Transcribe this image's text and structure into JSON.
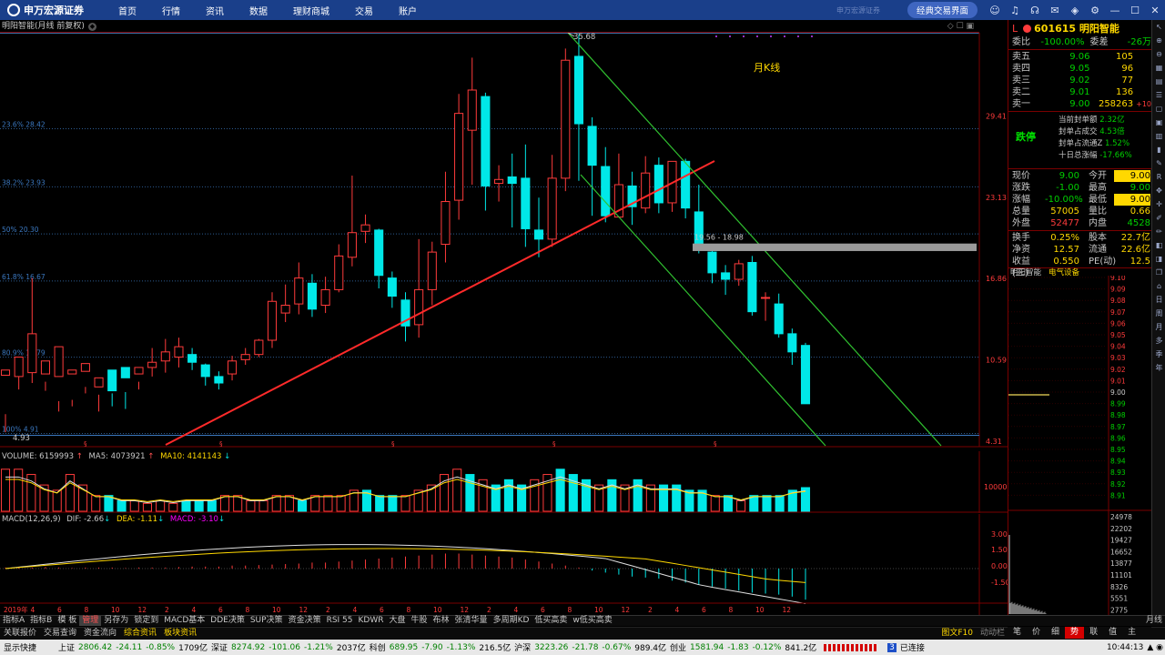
{
  "topbar": {
    "logo": "申万宏源证券",
    "menu": [
      "首页",
      "行情",
      "资讯",
      "数据",
      "理财商城",
      "交易",
      "账户"
    ],
    "broker_text": "申万宏源证券",
    "classic_button": "经典交易界面"
  },
  "chart": {
    "title": "明阳智能(月线 前复权)",
    "period_label": "月K线",
    "high_label": "35.68",
    "low_label": "4.93",
    "gap_label": "19.56 - 18.98",
    "fib_labels": [
      "23.6% 28.42",
      "38.2% 23.93",
      "50% 20.30",
      "61.8% 16.67",
      "80.9% 10.79",
      "100% 4.91"
    ],
    "price_axis": [
      "29.41",
      "23.13",
      "16.86",
      "10.59",
      "4.31"
    ],
    "time_axis": [
      "2019年",
      "4",
      "6",
      "8",
      "10",
      "12",
      "2",
      "4",
      "6",
      "8",
      "10",
      "12",
      "2",
      "4",
      "6",
      "8",
      "10",
      "12",
      "2",
      "4",
      "6",
      "8",
      "10",
      "12",
      "2",
      "4",
      "6",
      "8",
      "10",
      "12"
    ],
    "period_text": "月线"
  },
  "chart_data": {
    "type": "candlestick",
    "ylim": [
      4.31,
      35.68
    ],
    "candles": [
      [
        9.4,
        9.8,
        6.4,
        5.0
      ],
      [
        9.3,
        10.8,
        9.4,
        8.3
      ],
      [
        9.6,
        12.6,
        16.9,
        8.8
      ],
      [
        9.5,
        10.5,
        8.9,
        8.2
      ],
      [
        9.3,
        11.6,
        7.4,
        6.6
      ],
      [
        9.5,
        9.8,
        7.5,
        7.0
      ],
      [
        9.7,
        10.3,
        8.5,
        8.0
      ],
      [
        8.5,
        9.2,
        6.6,
        7.9
      ],
      [
        9.8,
        8.2,
        8.0,
        7.0
      ],
      [
        10.0,
        9.2,
        6.8,
        8.1
      ],
      [
        9.5,
        10.0,
        8.9,
        8.3
      ],
      [
        10.0,
        10.4,
        11.5,
        9.3
      ],
      [
        10.5,
        11.2,
        12.2,
        9.6
      ],
      [
        10.8,
        11.6,
        12.3,
        10.0
      ],
      [
        11.0,
        10.4,
        11.5,
        9.8
      ],
      [
        10.2,
        9.3,
        10.3,
        8.6
      ],
      [
        9.3,
        8.8,
        9.7,
        8.3
      ],
      [
        9.5,
        10.5,
        10.9,
        9.0
      ],
      [
        10.6,
        11.0,
        11.5,
        10.2
      ],
      [
        11.0,
        12.1,
        12.2,
        10.8
      ],
      [
        12.1,
        15.1,
        15.8,
        11.5
      ],
      [
        14.2,
        14.8,
        16.4,
        13.5
      ],
      [
        14.9,
        16.9,
        18.1,
        14.1
      ],
      [
        16.5,
        14.5,
        17.2,
        13.9
      ],
      [
        14.8,
        16.0,
        17.0,
        14.2
      ],
      [
        16.0,
        18.6,
        19.5,
        15.8
      ],
      [
        18.5,
        20.4,
        24.8,
        17.8
      ],
      [
        20.5,
        21.0,
        21.8,
        19.6
      ],
      [
        20.6,
        17.1,
        20.7,
        16.1
      ],
      [
        16.9,
        15.5,
        17.4,
        14.6
      ],
      [
        15.2,
        13.2,
        15.8,
        12.0
      ],
      [
        13.3,
        16.0,
        19.9,
        12.3
      ],
      [
        16.0,
        18.9,
        19.7,
        14.8
      ],
      [
        19.5,
        22.8,
        25.1,
        18.1
      ],
      [
        22.9,
        29.6,
        31.1,
        21.4
      ],
      [
        28.3,
        31.4,
        33.9,
        24.1
      ],
      [
        30.9,
        24.0,
        31.2,
        22.1
      ],
      [
        24.2,
        24.5,
        25.6,
        22.8
      ],
      [
        24.7,
        24.2,
        26.5,
        20.8
      ],
      [
        24.6,
        20.7,
        27.2,
        19.3
      ],
      [
        20.6,
        19.9,
        23.1,
        18.5
      ],
      [
        19.9,
        24.6,
        26.4,
        19.3
      ],
      [
        24.6,
        33.7,
        34.6,
        23.6
      ],
      [
        34.0,
        28.8,
        35.7,
        24.4
      ],
      [
        28.6,
        25.6,
        29.3,
        21.7
      ],
      [
        25.5,
        21.7,
        27.0,
        21.2
      ],
      [
        21.6,
        24.1,
        26.5,
        22.1
      ],
      [
        24.0,
        22.4,
        25.1,
        21.0
      ],
      [
        22.3,
        25.0,
        26.3,
        21.9
      ],
      [
        25.6,
        22.7,
        26.2,
        21.9
      ],
      [
        22.7,
        25.9,
        25.9,
        22.0
      ],
      [
        25.9,
        22.3,
        26.1,
        21.5
      ],
      [
        22.0,
        19.1,
        24.1,
        18.8
      ],
      [
        18.9,
        17.3,
        19.5,
        16.5
      ],
      [
        17.3,
        16.8,
        17.9,
        15.6
      ],
      [
        16.8,
        18.0,
        18.3,
        16.3
      ],
      [
        18.1,
        14.3,
        18.6,
        14.0
      ],
      [
        15.4,
        15.4,
        15.8,
        13.6
      ],
      [
        14.9,
        12.6,
        15.7,
        12.3
      ],
      [
        12.6,
        11.2,
        13.0,
        10.2
      ],
      [
        11.7,
        7.2,
        11.9,
        7.2
      ]
    ],
    "volume": {
      "label": "VOLUME: 6159993",
      "ma5": "MA5: 4073921",
      "ma10": "MA10: 4141143",
      "axis": "10000",
      "bars": [
        8,
        8,
        7,
        5,
        4,
        7,
        5,
        3,
        3,
        2,
        2,
        1.5,
        2,
        1.5,
        2,
        2,
        2,
        3,
        3,
        2,
        2,
        3,
        3,
        2,
        3,
        3,
        3,
        4,
        4,
        3,
        3,
        3,
        4,
        5,
        7,
        8,
        7,
        6,
        5,
        6,
        5,
        6,
        7,
        8,
        7,
        6,
        5,
        6,
        5,
        6,
        5,
        5,
        5,
        4,
        4,
        3,
        3,
        2,
        3,
        3,
        3,
        4,
        4.5
      ]
    },
    "macd": {
      "label": "MACD(12,26,9)",
      "dif": "DIF: -2.66",
      "dea": "DEA: -1.11",
      "macd": "MACD: -3.10",
      "axis": [
        "3.00",
        "1.50",
        "0.00",
        "-1.50"
      ]
    }
  },
  "quote": {
    "code": "601615",
    "name": "明阳智能",
    "order_ratio_label": "委比",
    "order_ratio": "-100.00%",
    "order_diff_label": "委差",
    "order_diff": "-26万",
    "sells": [
      {
        "label": "卖五",
        "price": "9.06",
        "vol": "105",
        "chg": ""
      },
      {
        "label": "卖四",
        "price": "9.05",
        "vol": "96",
        "chg": ""
      },
      {
        "label": "卖三",
        "price": "9.02",
        "vol": "77",
        "chg": ""
      },
      {
        "label": "卖二",
        "price": "9.01",
        "vol": "136",
        "chg": ""
      },
      {
        "label": "卖一",
        "price": "9.00",
        "vol": "258263",
        "chg": "+10"
      }
    ],
    "limit_label": "跌停",
    "limit_rows": [
      {
        "k": "当前封单额",
        "v": "2.32亿"
      },
      {
        "k": "封单占成交",
        "v": "4.53倍"
      },
      {
        "k": "封单占流通Z",
        "v": "1.52%"
      },
      {
        "k": "十日总涨幅",
        "v": "-17.66%"
      }
    ],
    "stats": [
      {
        "a": "现价",
        "b": "9.00",
        "c": "今开",
        "d": "9.00"
      },
      {
        "a": "涨跌",
        "b": "-1.00",
        "c": "最高",
        "d": "9.00"
      },
      {
        "a": "涨幅",
        "b": "-10.00%",
        "c": "最低",
        "d": "9.00"
      },
      {
        "a": "总量",
        "b": "57005",
        "c": "量比",
        "d": "0.66"
      },
      {
        "a": "外盘",
        "b": "52477",
        "c": "内盘",
        "d": "4528"
      },
      {
        "a": "换手",
        "b": "0.25%",
        "c": "股本",
        "d": "22.7亿"
      },
      {
        "a": "净资",
        "b": "12.57",
        "c": "流通",
        "d": "22.6亿"
      },
      {
        "a": "收益(三)",
        "b": "0.550",
        "c": "PE(动)",
        "d": "12.5"
      }
    ],
    "panel_tabs": [
      "明阳智能",
      "电气设备"
    ],
    "mini_axis": [
      "9.10",
      "9.09",
      "9.08",
      "9.07",
      "9.06",
      "9.05",
      "9.04",
      "9.03",
      "9.02",
      "9.01",
      "9.00",
      "8.99",
      "8.98",
      "8.97",
      "8.96",
      "8.95",
      "8.94",
      "8.93",
      "8.92",
      "8.91"
    ],
    "mini_vol_axis": [
      "24978",
      "22202",
      "19427",
      "16652",
      "13877",
      "11101",
      "8326",
      "5551",
      "2775"
    ],
    "bottom_tabs": [
      "笔",
      "价",
      "细",
      "势",
      "联",
      "值",
      "主"
    ]
  },
  "tabs": [
    "指标A",
    "指标B",
    "模 板",
    "管理",
    "另存为",
    "锁定到",
    "MACD基本",
    "DDE决策",
    "SUP决策",
    "资金决策",
    "RSI 55",
    "KDWR",
    "大盘",
    "牛股",
    "布林",
    "张清华量",
    "多周期KD",
    "低买高卖",
    "w低买高卖"
  ],
  "active_tab": "管理",
  "links": [
    "关联报价",
    "交易查询",
    "资金流向",
    "综合资讯",
    "板块资讯"
  ],
  "links_right": [
    "图文F10",
    "动动栏"
  ],
  "status": {
    "app": "显示快捷",
    "sh_label": "上证",
    "sh": "2806.42",
    "sh_chg": "-24.11",
    "sh_pct": "-0.85%",
    "sh_amt": "1709亿",
    "sz_label": "深证",
    "sz": "8274.92",
    "sz_chg": "-101.06",
    "sz_pct": "-1.21%",
    "sz_amt": "2037亿",
    "kc_label": "科创",
    "kc": "689.95",
    "kc_chg": "-7.90",
    "kc_pct": "-1.13%",
    "kc_amt": "216.5亿",
    "hs_label": "沪深",
    "hs": "3223.26",
    "hs_chg": "-21.78",
    "hs_pct": "-0.67%",
    "hs_amt": "989.4亿",
    "cy_label": "创业",
    "cy": "1581.94",
    "cy_chg": "-1.83",
    "cy_pct": "-0.12%",
    "cy_amt": "841.2亿",
    "conn": "已连接",
    "time": "10:44:13"
  }
}
